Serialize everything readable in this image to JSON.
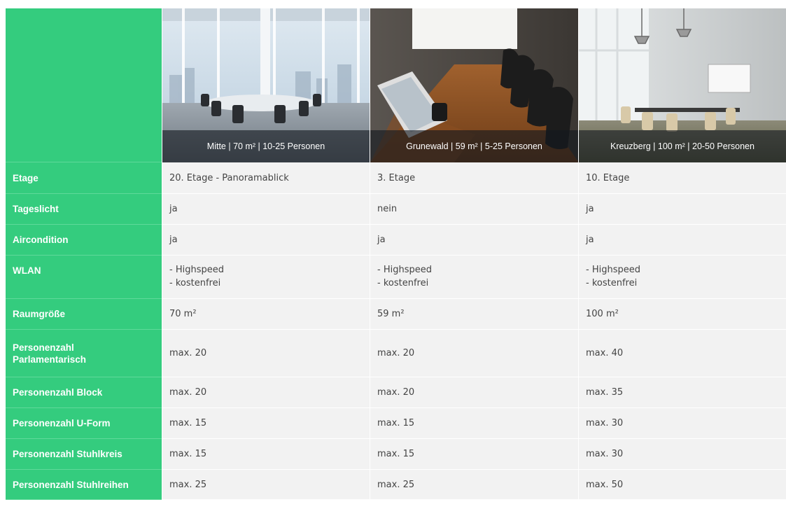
{
  "rooms": [
    {
      "caption": "Mitte | 70 m² | 10-25 Personen",
      "etage": "20. Etage - Panoramablick",
      "tageslicht": "ja",
      "aircondition": "ja",
      "wlan": [
        "- Highspeed",
        "- kostenfrei"
      ],
      "raumgroesse": "70 m²",
      "parlamentarisch": "max. 20",
      "block": "max. 20",
      "uform": "max. 15",
      "stuhlkreis": "max. 15",
      "stuhlreihen": "max. 25"
    },
    {
      "caption": "Grunewald | 59 m² | 5-25 Personen",
      "etage": "3. Etage",
      "tageslicht": "nein",
      "aircondition": "ja",
      "wlan": [
        "- Highspeed",
        "- kostenfrei"
      ],
      "raumgroesse": "59 m²",
      "parlamentarisch": "max. 20",
      "block": "max. 20",
      "uform": "max. 15",
      "stuhlkreis": "max. 15",
      "stuhlreihen": "max. 25"
    },
    {
      "caption": "Kreuzberg | 100 m² | 20-50 Personen",
      "etage": "10. Etage",
      "tageslicht": "ja",
      "aircondition": "ja",
      "wlan": [
        "- Highspeed",
        "- kostenfrei"
      ],
      "raumgroesse": "100 m²",
      "parlamentarisch": "max. 40",
      "block": "max. 35",
      "uform": "max. 30",
      "stuhlkreis": "max. 30",
      "stuhlreihen": "max. 50"
    }
  ],
  "labels": {
    "etage": "Etage",
    "tageslicht": "Tageslicht",
    "aircondition": "Aircondition",
    "wlan": "WLAN",
    "raumgroesse": "Raumgröße",
    "parlamentarisch_1": "Personenzahl",
    "parlamentarisch_2": "Parlamentarisch",
    "block": "Personenzahl Block",
    "uform": "Personenzahl U-Form",
    "stuhlkreis": "Personenzahl Stuhlkreis",
    "stuhlreihen": "Personenzahl Stuhlreihen"
  },
  "colors": {
    "label_bg": "#34cc7e",
    "value_bg": "#f2f2f2",
    "value_text": "#444444"
  }
}
